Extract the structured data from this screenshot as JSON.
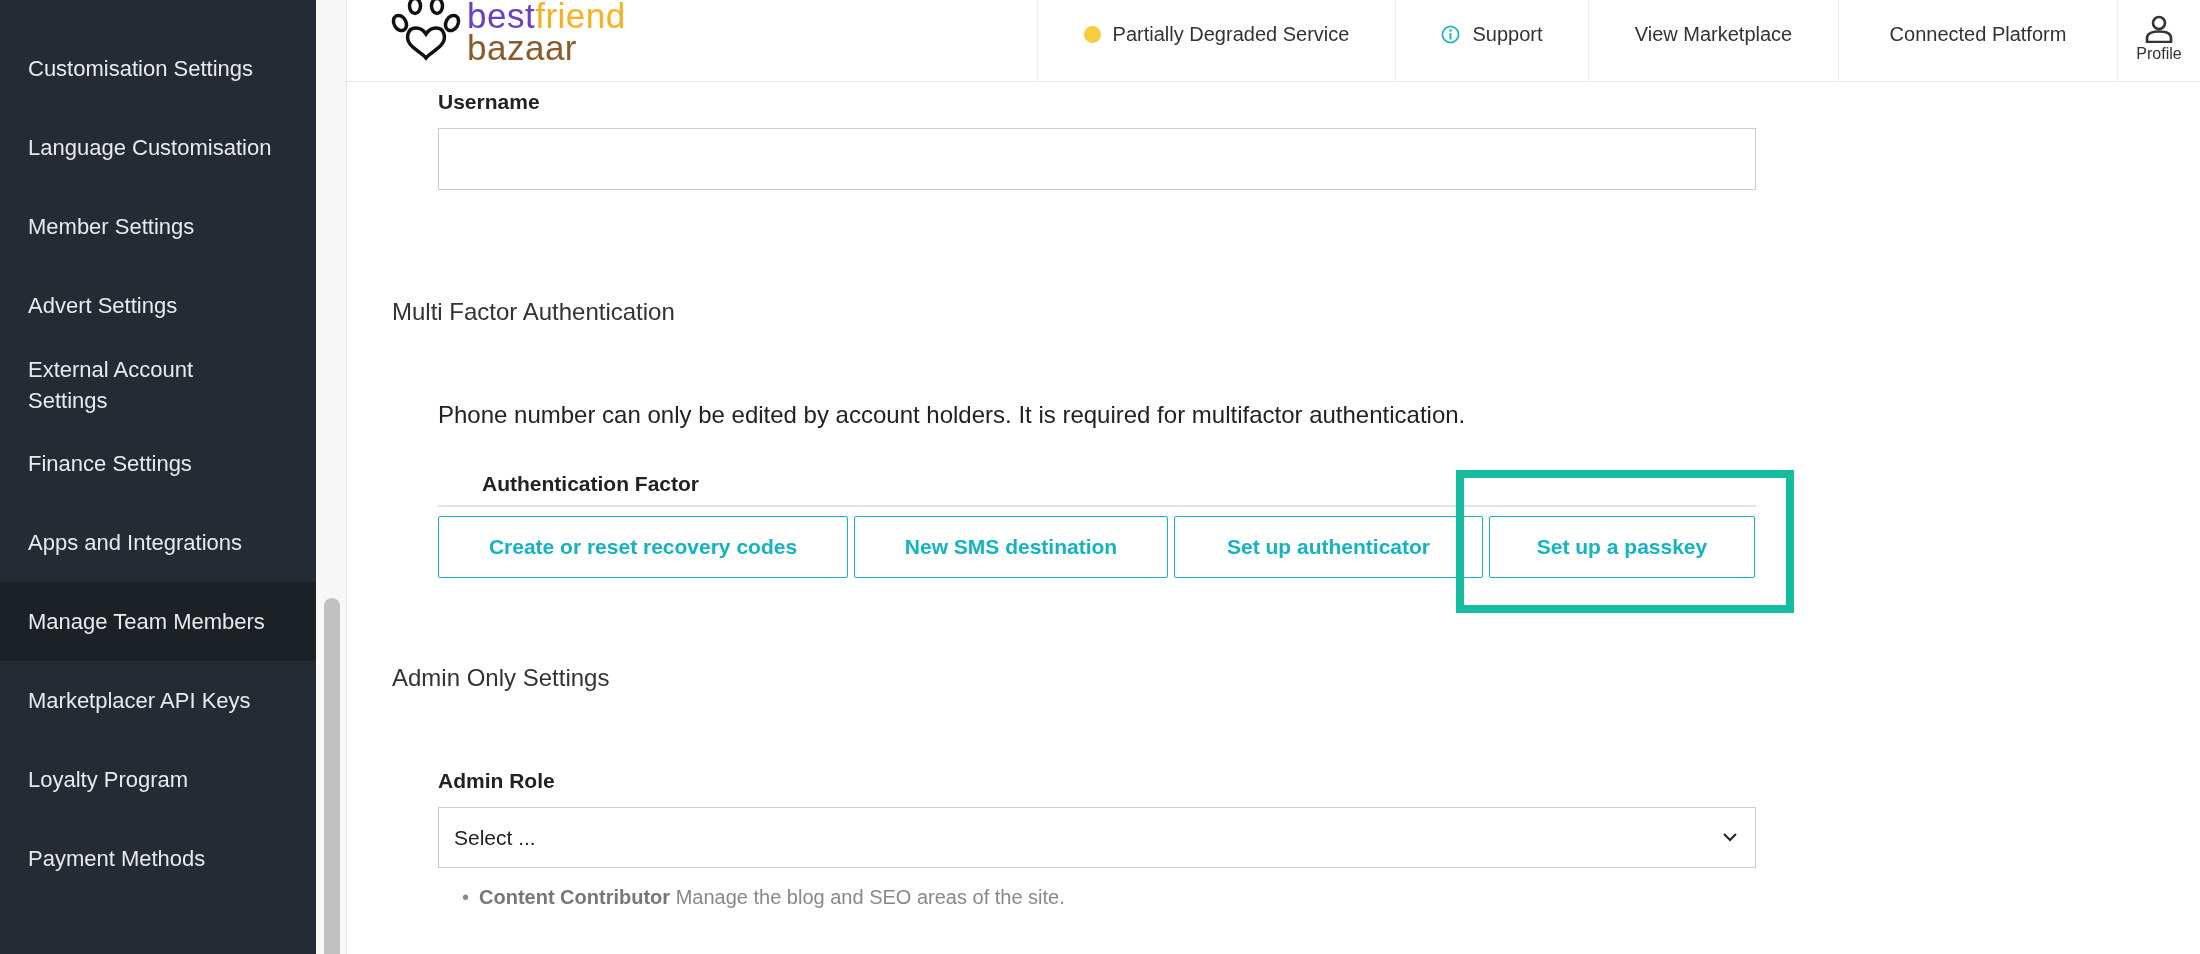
{
  "sidebar": {
    "items": [
      {
        "label": "Customisation Settings",
        "selected": false
      },
      {
        "label": "Language Customisation",
        "selected": false
      },
      {
        "label": "Member Settings",
        "selected": false
      },
      {
        "label": "Advert Settings",
        "selected": false
      },
      {
        "label": "External Account Settings",
        "selected": false
      },
      {
        "label": "Finance Settings",
        "selected": false
      },
      {
        "label": "Apps and Integrations",
        "selected": false
      },
      {
        "label": "Manage Team Members",
        "selected": true
      },
      {
        "label": "Marketplacer API Keys",
        "selected": false
      },
      {
        "label": "Loyalty Program",
        "selected": false
      },
      {
        "label": "Payment Methods",
        "selected": false
      }
    ]
  },
  "header": {
    "logo": {
      "first_line": [
        "best",
        "friend"
      ],
      "second_line": "bazaar"
    },
    "nav": [
      {
        "kind": "status",
        "label": "Partially Degraded Service",
        "color": "#f6cd3a"
      },
      {
        "kind": "support",
        "label": "Support"
      },
      {
        "kind": "link",
        "label": "View Marketplace"
      },
      {
        "kind": "link",
        "label": "Connected Platform"
      },
      {
        "kind": "profile",
        "label": "Profile"
      }
    ]
  },
  "form": {
    "username": {
      "label": "Username"
    },
    "mfa": {
      "title": "Multi Factor Authentication",
      "note": "Phone number can only be edited by account holders. It is required for multifactor authentication.",
      "column_header": "Authentication Factor",
      "buttons": [
        {
          "label": "Create or reset recovery codes",
          "highlighted": false
        },
        {
          "label": "New SMS destination",
          "highlighted": false
        },
        {
          "label": "Set up authenticator",
          "highlighted": false
        },
        {
          "label": "Set up a passkey",
          "highlighted": true
        }
      ]
    },
    "admin": {
      "title": "Admin Only Settings",
      "role": {
        "label": "Admin Role",
        "value": "Select ..."
      },
      "roles": [
        {
          "marker": "•",
          "name": "Content Contributor",
          "description": "Manage the blog and SEO areas of the site."
        }
      ]
    }
  }
}
